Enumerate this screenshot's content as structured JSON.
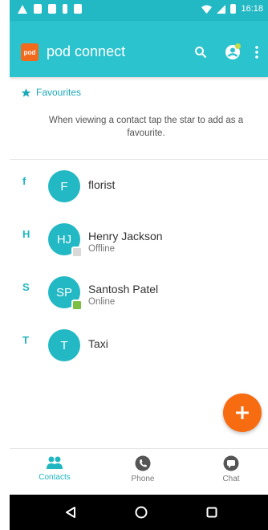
{
  "status_bar": {
    "time": "16:18"
  },
  "app": {
    "logo_text": "pod",
    "title": "pod connect"
  },
  "favourites": {
    "heading": "Favourites",
    "message": "When viewing a contact tap the star to add as a favourite."
  },
  "contacts": [
    {
      "letter": "f",
      "initials": "F",
      "name": "florist",
      "status": "",
      "presence_color": ""
    },
    {
      "letter": "H",
      "initials": "HJ",
      "name": "Henry Jackson",
      "status": "Offline",
      "presence_color": "#d8d8d8"
    },
    {
      "letter": "S",
      "initials": "SP",
      "name": "Santosh Patel",
      "status": "Online",
      "presence_color": "#7bc043"
    },
    {
      "letter": "T",
      "initials": "T",
      "name": "Taxi",
      "status": "",
      "presence_color": ""
    }
  ],
  "bottom_nav": {
    "contacts": "Contacts",
    "phone": "Phone",
    "chat": "Chat"
  },
  "colors": {
    "primary": "#2bc3cd",
    "accent": "#f76b11",
    "online": "#7bc043"
  }
}
